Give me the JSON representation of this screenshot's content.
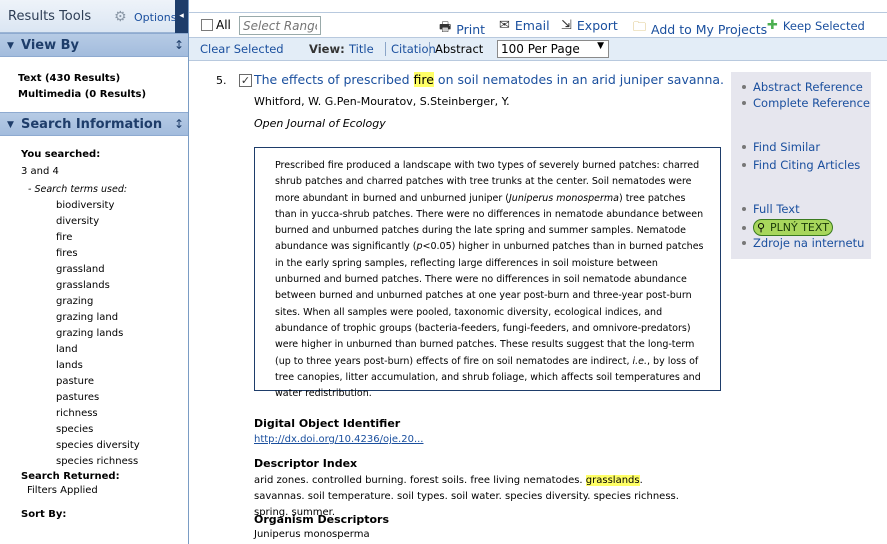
{
  "sidebar": {
    "title": "Results Tools",
    "options_label": "Options",
    "collapse_icon": "◂",
    "view_by": {
      "heading": "View By",
      "items": [
        "Text (430 Results)",
        "Multimedia (0 Results)"
      ]
    },
    "search_info": {
      "heading": "Search Information",
      "you_searched": "You searched:",
      "query": "3 and 4",
      "terms_label": "- Search terms used:",
      "terms": [
        "biodiversity",
        "diversity",
        "fire",
        "fires",
        "grassland",
        "grasslands",
        "grazing",
        "grazing land",
        "grazing lands",
        "land",
        "lands",
        "pasture",
        "pastures",
        "richness",
        "species",
        "species diversity",
        "species richness"
      ],
      "returned_label": "Search Returned:",
      "filters": "Filters Applied",
      "sort_label": "Sort By:"
    }
  },
  "toolbar": {
    "all_label": "All",
    "range_placeholder": "Select Range",
    "print": "Print",
    "email": "Email",
    "export": "Export",
    "add_projects": "Add to My Projects",
    "keep_selected": "Keep Selected",
    "clear_selected": "Clear Selected",
    "view_label": "View:",
    "view_title": "Title",
    "view_citation": "Citation",
    "view_abstract": "Abstract",
    "per_page": "100 Per Page"
  },
  "result": {
    "number": "5.",
    "title_before": "The effects of prescribed ",
    "title_highlight": "fire",
    "title_after": " on soil nematodes in an arid juniper savanna.",
    "authors": "Whitford, W. G.Pen-Mouratov, S.Steinberger, Y.",
    "journal": "Open Journal of Ecology",
    "abstract_1": "Prescribed fire produced a landscape with two types of severely burned patches: charred shrub patches and charred patches with tree trunks at the center. Soil nematodes were more abundant in burned and unburned juniper (",
    "abstract_species": "Juniperus monosperma",
    "abstract_2": ") tree patches than in yucca-shrub patches. There were no differences in nematode abundance between burned and unburned patches during the late spring and summer samples. Nematode abundance was significantly (",
    "abstract_p": "p",
    "abstract_3": "<0.05) higher in unburned patches than in burned patches in the early spring samples, reflecting large differences in soil moisture between unburned and burned patches. There were no differences in soil nematode abundance between burned and unburned patches at one year post-burn and three-year post-burn sites. When all samples were pooled, taxonomic diversity, ecological indices, and abundance of trophic groups (bacteria-feeders, fungi-feeders, and omnivore-predators) were higher in unburned than burned patches. These results suggest that the long-term (up to three years post-burn) effects of fire on soil nematodes are indirect, ",
    "abstract_ie": "i.e.",
    "abstract_4": ", by loss of tree canopies, litter accumulation, and shrub foliage, which affects soil temperatures and water redistribution.",
    "doi_label": "Digital Object Identifier",
    "doi": "http://dx.doi.org/10.4236/oje.20...",
    "descriptor_label": "Descriptor Index",
    "descriptor_before": "arid zones. controlled burning. forest soils. free living nematodes. ",
    "descriptor_highlight": "grasslands",
    "descriptor_after": ". savannas. soil temperature. soil types. soil water. species diversity. species richness. spring. summer.",
    "organism_label": "Organism Descriptors",
    "organism": "Juniperus monosperma"
  },
  "links": {
    "abstract_ref": "Abstract Reference",
    "complete_ref": "Complete Reference",
    "find_similar": "Find Similar",
    "find_citing": "Find Citing Articles",
    "full_text": "Full Text",
    "plny_text": "PLNÝ TEXT",
    "zdroje": "Zdroje na internetu"
  }
}
